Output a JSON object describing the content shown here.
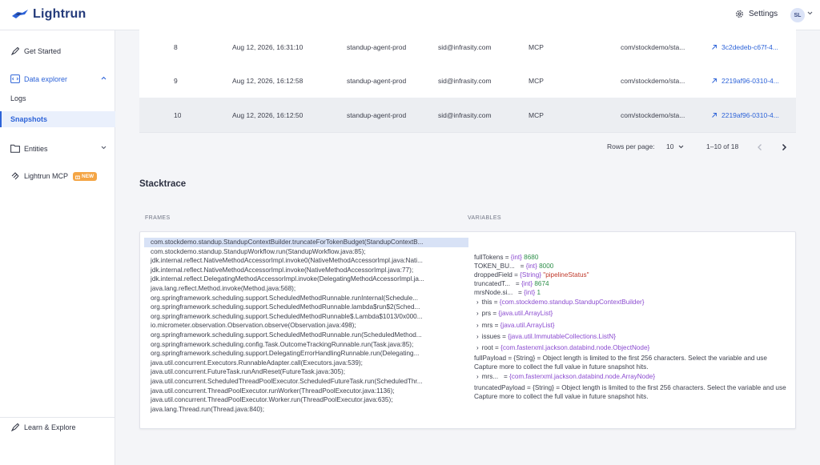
{
  "app": {
    "logo_text": "Lightrun",
    "settings_label": "Settings",
    "avatar_initials": "SL"
  },
  "sidebar": {
    "get_started": "Get Started",
    "data_explorer": "Data explorer",
    "logs": "Logs",
    "snapshots": "Snapshots",
    "entities": "Entities",
    "mcp": "Lightrun MCP",
    "new_badge": "NEW",
    "learn": "Learn & Explore"
  },
  "table": {
    "rows": [
      {
        "num": "8",
        "date": "Aug 12, 2026, 16:31:10",
        "agent": "standup-agent-prod",
        "user": "sid@infrasity.com",
        "source": "MCP",
        "location": "com/stockdemo/sta...",
        "id": "3c2dedeb-c67f-4..."
      },
      {
        "num": "9",
        "date": "Aug 12, 2026, 16:12:58",
        "agent": "standup-agent-prod",
        "user": "sid@infrasity.com",
        "source": "MCP",
        "location": "com/stockdemo/sta...",
        "id": "2219af96-0310-4..."
      },
      {
        "num": "10",
        "date": "Aug 12, 2026, 16:12:50",
        "agent": "standup-agent-prod",
        "user": "sid@infrasity.com",
        "source": "MCP",
        "location": "com/stockdemo/sta...",
        "id": "2219af96-0310-4..."
      }
    ]
  },
  "pagination": {
    "rows_per_page_label": "Rows per page:",
    "rows_per_page": "10",
    "range": "1–10 of 18"
  },
  "stacktrace": {
    "title": "Stacktrace",
    "frames_header": "FRAMES",
    "variables_header": "VARIABLES",
    "frames": [
      "com.stockdemo.standup.StandupContextBuilder.truncateForTokenBudget(StandupContextB...",
      "com.stockdemo.standup.StandupWorkflow.run(StandupWorkflow.java:85);",
      "jdk.internal.reflect.NativeMethodAccessorImpl.invoke0(NativeMethodAccessorImpl.java:Nati...",
      "jdk.internal.reflect.NativeMethodAccessorImpl.invoke(NativeMethodAccessorImpl.java:77);",
      "jdk.internal.reflect.DelegatingMethodAccessorImpl.invoke(DelegatingMethodAccessorImpl.ja...",
      "java.lang.reflect.Method.invoke(Method.java:568);",
      "org.springframework.scheduling.support.ScheduledMethodRunnable.runInternal(Schedule...",
      "org.springframework.scheduling.support.ScheduledMethodRunnable.lambda$run$2(Sched...",
      "org.springframework.scheduling.support.ScheduledMethodRunnable$.Lambda$1013/0x000...",
      "io.micrometer.observation.Observation.observe(Observation.java:498);",
      "org.springframework.scheduling.support.ScheduledMethodRunnable.run(ScheduledMethod...",
      "org.springframework.scheduling.config.Task.OutcomeTrackingRunnable.run(Task.java:85);",
      "org.springframework.scheduling.support.DelegatingErrorHandlingRunnable.run(Delegating...",
      "java.util.concurrent.Executors.RunnableAdapter.call(Executors.java:539);",
      "java.util.concurrent.FutureTask.runAndReset(FutureTask.java:305);",
      "java.util.concurrent.ScheduledThreadPoolExecutor.ScheduledFutureTask.run(ScheduledThr...",
      "java.util.concurrent.ThreadPoolExecutor.runWorker(ThreadPoolExecutor.java:1136);",
      "java.util.concurrent.ThreadPoolExecutor.Worker.run(ThreadPoolExecutor.java:635);",
      "java.lang.Thread.run(Thread.java:840);"
    ],
    "variables": {
      "full_tokens": {
        "name": "fullTokens",
        "type": "{int}",
        "value": "8680"
      },
      "token_budget": {
        "name": "TOKEN_BU...",
        "type": "{int}",
        "value": "8000"
      },
      "dropped_field": {
        "name": "droppedField",
        "type": "{String}",
        "value": "\"pipelineStatus\""
      },
      "truncated_tokens": {
        "name": "truncatedT...",
        "type": "{int}",
        "value": "8674"
      },
      "mrs_node_size": {
        "name": "mrsNode.si...",
        "type": "{int}",
        "value": "1"
      },
      "this_var": {
        "name": "this",
        "type": "{com.stockdemo.standup.StandupContextBuilder}"
      },
      "prs": {
        "name": "prs",
        "type": "{java.util.ArrayList}"
      },
      "mrs": {
        "name": "mrs",
        "type": "{java.util.ArrayList}"
      },
      "issues": {
        "name": "issues",
        "type": "{java.util.ImmutableCollections.ListN}"
      },
      "root": {
        "name": "root",
        "type": "{com.fasterxml.jackson.databind.node.ObjectNode}"
      },
      "full_payload": {
        "name": "fullPayload",
        "type": "{String}",
        "message": "Object length is limited to the first 256 characters. Select the variable and use Capture more to collect the full value in future snapshot hits."
      },
      "mrs_node": {
        "name": "mrs...",
        "type": "{com.fasterxml.jackson.databind.node.ArrayNode}"
      },
      "truncated_payload": {
        "name": "truncatedPayload",
        "type": "{String}",
        "message": "Object length is limited to the first 256 characters. Select the variable and use Capture more to collect the full value in future snapshot hits."
      }
    }
  }
}
